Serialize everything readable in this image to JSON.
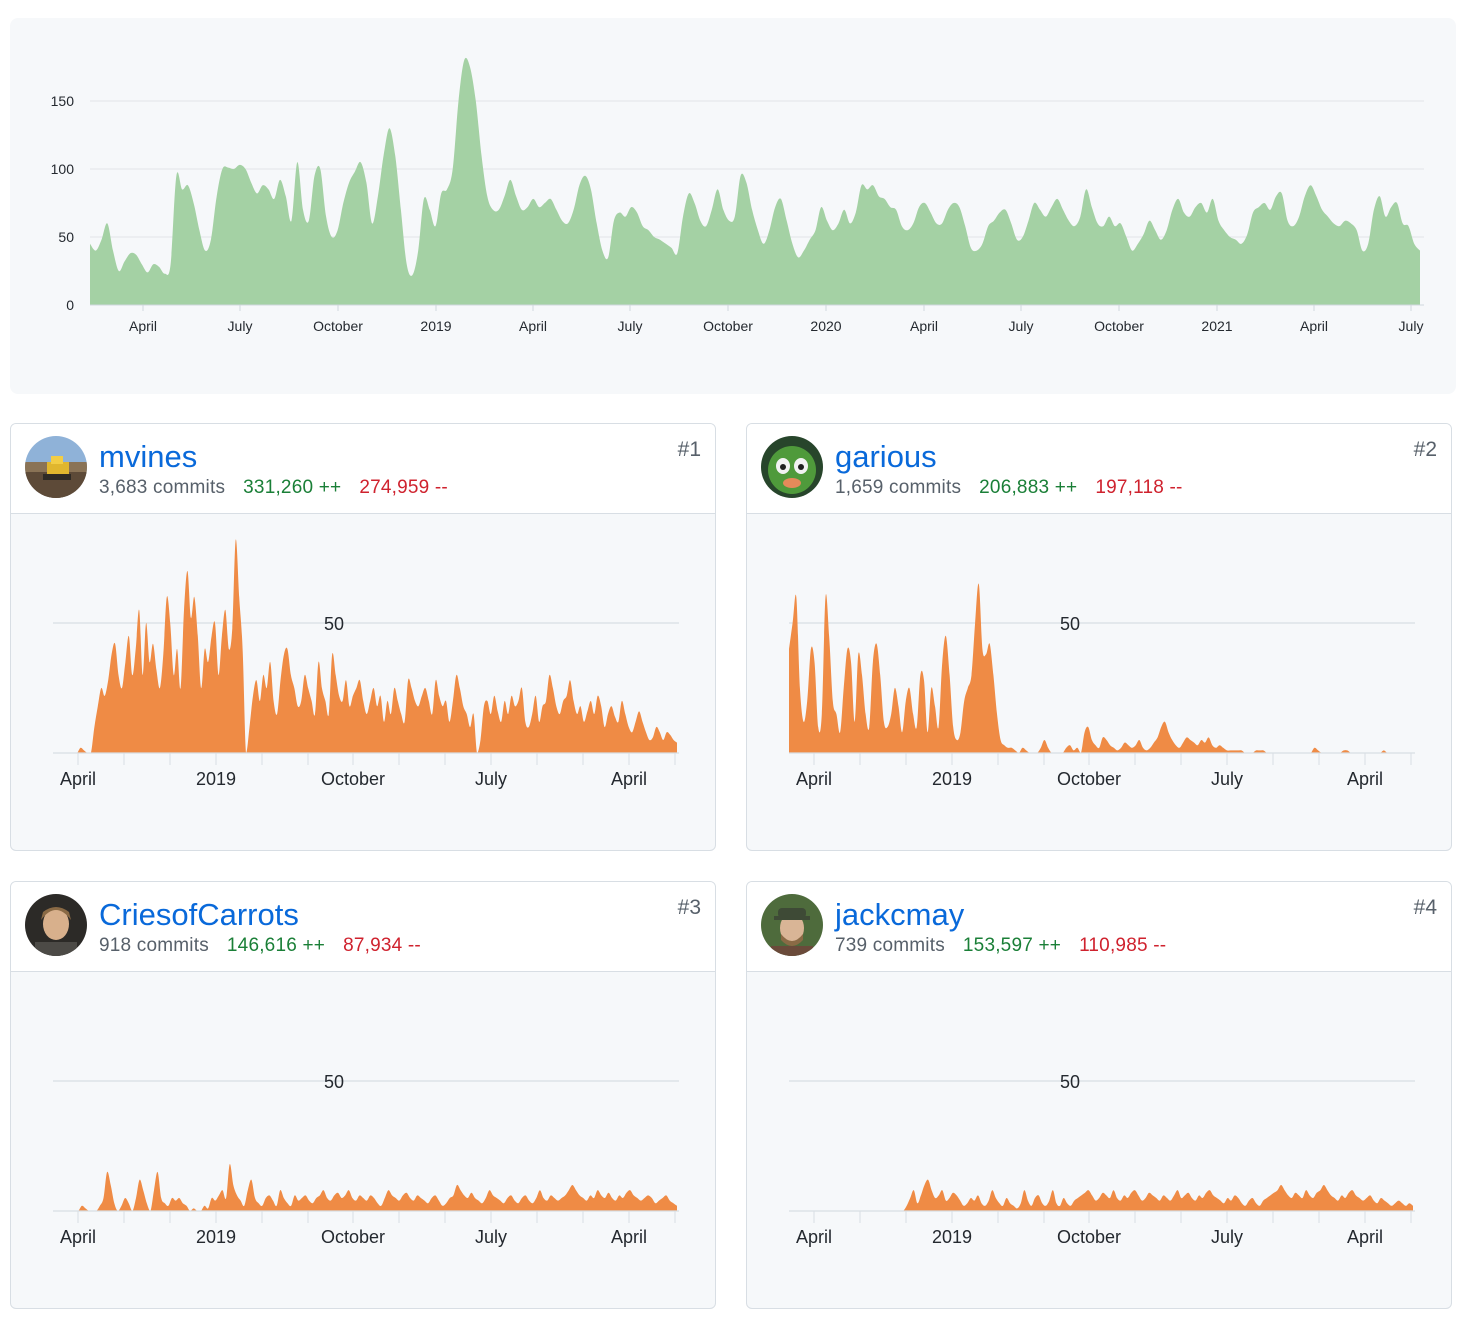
{
  "overview": {
    "chart_data": {
      "type": "area",
      "x_ticks": [
        "April",
        "July",
        "October",
        "2019",
        "April",
        "July",
        "October",
        "2020",
        "April",
        "July",
        "October",
        "2021",
        "April",
        "July"
      ],
      "y_ticks": [
        0,
        50,
        100,
        150
      ],
      "ylim": [
        0,
        190
      ],
      "series": [
        {
          "values": [
            45,
            40,
            48,
            60,
            40,
            25,
            32,
            38,
            37,
            30,
            24,
            30,
            28,
            23,
            30,
            95,
            85,
            88,
            75,
            55,
            40,
            48,
            80,
            100,
            101,
            100,
            103,
            100,
            90,
            82,
            88,
            85,
            78,
            92,
            80,
            62,
            105,
            70,
            62,
            95,
            100,
            65,
            50,
            55,
            75,
            90,
            98,
            105,
            90,
            60,
            80,
            110,
            130,
            110,
            70,
            30,
            22,
            40,
            78,
            70,
            58,
            82,
            85,
            100,
            150,
            180,
            175,
            150,
            110,
            80,
            70,
            70,
            80,
            92,
            80,
            70,
            72,
            78,
            72,
            75,
            78,
            70,
            62,
            60,
            70,
            88,
            95,
            85,
            60,
            40,
            35,
            62,
            68,
            65,
            72,
            68,
            58,
            55,
            50,
            48,
            45,
            42,
            38,
            65,
            82,
            75,
            62,
            58,
            70,
            85,
            70,
            62,
            65,
            95,
            90,
            70,
            55,
            45,
            55,
            72,
            78,
            62,
            45,
            35,
            40,
            48,
            55,
            72,
            62,
            55,
            60,
            70,
            60,
            68,
            88,
            85,
            88,
            80,
            78,
            72,
            70,
            58,
            55,
            60,
            72,
            75,
            68,
            60,
            60,
            70,
            75,
            72,
            58,
            42,
            40,
            45,
            58,
            62,
            68,
            70,
            60,
            48,
            50,
            62,
            75,
            70,
            65,
            72,
            78,
            70,
            62,
            58,
            65,
            85,
            72,
            60,
            58,
            65,
            58,
            60,
            50,
            40,
            45,
            52,
            62,
            55,
            48,
            55,
            70,
            78,
            68,
            65,
            72,
            75,
            68,
            78,
            62,
            55,
            50,
            48,
            45,
            52,
            68,
            72,
            75,
            70,
            80,
            82,
            62,
            58,
            65,
            80,
            88,
            80,
            70,
            65,
            60,
            58,
            62,
            60,
            55,
            40,
            45,
            70,
            80,
            65,
            72,
            75,
            60,
            58,
            45,
            40
          ]
        }
      ]
    }
  },
  "contributors": [
    {
      "rank": "#1",
      "username": "mvines",
      "commits": "3,683 commits",
      "additions": "331,260 ++",
      "deletions": "274,959 --",
      "avatar_icon": "bulldozer-avatar-icon",
      "chart_data": {
        "type": "area",
        "x_ticks": [
          "April",
          "2019",
          "October",
          "July",
          "April"
        ],
        "gridline_label": "50",
        "ylim": [
          0,
          80
        ],
        "series": [
          {
            "values": [
              0,
              0,
              0,
              0,
              0,
              0,
              0,
              0,
              2,
              1,
              0,
              0,
              10,
              18,
              25,
              22,
              28,
              38,
              42,
              30,
              25,
              35,
              45,
              30,
              40,
              55,
              30,
              50,
              35,
              42,
              32,
              25,
              38,
              60,
              50,
              30,
              40,
              25,
              55,
              70,
              52,
              60,
              45,
              25,
              40,
              35,
              45,
              50,
              30,
              45,
              55,
              40,
              48,
              82,
              60,
              40,
              0,
              10,
              22,
              28,
              20,
              30,
              25,
              35,
              20,
              15,
              28,
              38,
              40,
              30,
              25,
              18,
              20,
              30,
              25,
              20,
              15,
              35,
              25,
              20,
              15,
              38,
              30,
              22,
              20,
              28,
              18,
              22,
              25,
              28,
              20,
              15,
              20,
              25,
              18,
              22,
              12,
              20,
              15,
              25,
              20,
              15,
              12,
              28,
              25,
              20,
              18,
              22,
              25,
              20,
              15,
              28,
              22,
              18,
              20,
              12,
              20,
              30,
              25,
              18,
              15,
              10,
              15,
              0,
              5,
              18,
              20,
              15,
              22,
              16,
              12,
              20,
              15,
              22,
              18,
              20,
              25,
              12,
              10,
              15,
              22,
              12,
              18,
              20,
              30,
              25,
              18,
              15,
              20,
              22,
              28,
              20,
              15,
              18,
              12,
              16,
              20,
              15,
              22,
              18,
              10,
              15,
              18,
              14,
              12,
              20,
              15,
              10,
              8,
              12,
              16,
              12,
              8,
              5,
              6,
              10,
              8,
              5,
              8,
              7,
              5,
              4
            ],
            "color": "#ef8b45"
          }
        ]
      }
    },
    {
      "rank": "#2",
      "username": "garious",
      "commits": "1,659 commits",
      "additions": "206,883 ++",
      "deletions": "197,118 --",
      "avatar_icon": "green-mask-avatar-icon",
      "chart_data": {
        "type": "area",
        "x_ticks": [
          "April",
          "2019",
          "October",
          "July",
          "April"
        ],
        "gridline_label": "50",
        "ylim": [
          0,
          80
        ],
        "series": [
          {
            "values": [
              40,
              50,
              60,
              25,
              12,
              20,
              40,
              35,
              10,
              15,
              60,
              45,
              20,
              15,
              8,
              25,
              40,
              35,
              12,
              38,
              30,
              15,
              10,
              35,
              42,
              30,
              12,
              10,
              15,
              25,
              18,
              8,
              20,
              25,
              15,
              10,
              30,
              28,
              8,
              25,
              18,
              10,
              35,
              45,
              30,
              10,
              5,
              8,
              20,
              25,
              30,
              50,
              65,
              40,
              38,
              42,
              30,
              15,
              5,
              3,
              2,
              2,
              1,
              0,
              2,
              1,
              0,
              0,
              0,
              2,
              5,
              2,
              0,
              0,
              0,
              0,
              2,
              3,
              1,
              2,
              0,
              8,
              10,
              5,
              3,
              2,
              6,
              5,
              3,
              2,
              1,
              2,
              4,
              3,
              2,
              3,
              5,
              2,
              1,
              2,
              4,
              6,
              10,
              12,
              8,
              5,
              3,
              2,
              4,
              6,
              5,
              4,
              3,
              5,
              4,
              6,
              3,
              2,
              3,
              2,
              1,
              1,
              1,
              1,
              1,
              0,
              0,
              0,
              1,
              1,
              1,
              0,
              0,
              0,
              0,
              0,
              0,
              0,
              0,
              0,
              0,
              0,
              0,
              0,
              2,
              1,
              0,
              0,
              0,
              0,
              0,
              0,
              1,
              1,
              0,
              0,
              0,
              0,
              0,
              0,
              0,
              0,
              0,
              1,
              0,
              0,
              0,
              0,
              0,
              0,
              0,
              0
            ],
            "color": "#ef8b45"
          }
        ]
      }
    },
    {
      "rank": "#3",
      "username": "CriesofCarrots",
      "commits": "918 commits",
      "additions": "146,616 ++",
      "deletions": "87,934 --",
      "avatar_icon": "person-avatar-icon",
      "chart_data": {
        "type": "area",
        "x_ticks": [
          "April",
          "2019",
          "October",
          "July",
          "April"
        ],
        "gridline_label": "50",
        "ylim": [
          0,
          80
        ],
        "series": [
          {
            "values": [
              0,
              0,
              0,
              0,
              0,
              0,
              0,
              0,
              2,
              1,
              0,
              0,
              0,
              2,
              5,
              15,
              10,
              3,
              0,
              2,
              5,
              3,
              0,
              5,
              12,
              8,
              3,
              0,
              8,
              15,
              5,
              3,
              2,
              5,
              4,
              5,
              3,
              2,
              0,
              1,
              0,
              0,
              2,
              1,
              5,
              4,
              6,
              8,
              5,
              18,
              10,
              6,
              4,
              2,
              8,
              12,
              5,
              3,
              2,
              5,
              6,
              4,
              2,
              8,
              5,
              3,
              2,
              6,
              4,
              5,
              6,
              4,
              3,
              5,
              6,
              8,
              5,
              4,
              6,
              7,
              5,
              6,
              8,
              5,
              4,
              6,
              5,
              4,
              6,
              5,
              3,
              2,
              5,
              8,
              6,
              5,
              4,
              6,
              7,
              5,
              4,
              6,
              5,
              4,
              3,
              5,
              6,
              4,
              2,
              3,
              5,
              6,
              10,
              8,
              6,
              5,
              7,
              5,
              4,
              3,
              5,
              8,
              6,
              5,
              4,
              3,
              5,
              6,
              4,
              3,
              5,
              6,
              4,
              3,
              5,
              8,
              5,
              4,
              6,
              5,
              4,
              5,
              6,
              8,
              10,
              8,
              6,
              5,
              4,
              6,
              5,
              8,
              6,
              5,
              7,
              5,
              4,
              6,
              5,
              7,
              8,
              6,
              5,
              4,
              5,
              6,
              5,
              3,
              4,
              5,
              6,
              4,
              3,
              2
            ],
            "color": "#ef8b45"
          }
        ]
      }
    },
    {
      "rank": "#4",
      "username": "jackcmay",
      "commits": "739 commits",
      "additions": "153,597 ++",
      "deletions": "110,985 --",
      "avatar_icon": "person-hat-avatar-icon",
      "chart_data": {
        "type": "area",
        "x_ticks": [
          "April",
          "2019",
          "October",
          "July",
          "April"
        ],
        "gridline_label": "50",
        "ylim": [
          0,
          80
        ],
        "series": [
          {
            "values": [
              0,
              0,
              0,
              0,
              0,
              0,
              0,
              0,
              0,
              0,
              0,
              0,
              0,
              0,
              0,
              0,
              0,
              0,
              0,
              0,
              0,
              0,
              0,
              0,
              0,
              0,
              0,
              0,
              0,
              0,
              0,
              0,
              0,
              2,
              5,
              8,
              3,
              6,
              10,
              12,
              8,
              5,
              6,
              8,
              4,
              5,
              7,
              6,
              4,
              2,
              3,
              5,
              4,
              6,
              3,
              2,
              4,
              8,
              5,
              3,
              2,
              5,
              3,
              2,
              1,
              3,
              8,
              4,
              2,
              5,
              6,
              3,
              2,
              4,
              8,
              3,
              2,
              5,
              3,
              2,
              4,
              5,
              6,
              7,
              8,
              6,
              4,
              5,
              7,
              6,
              5,
              8,
              5,
              4,
              6,
              5,
              7,
              8,
              6,
              4,
              5,
              7,
              6,
              5,
              4,
              6,
              5,
              4,
              6,
              8,
              5,
              6,
              7,
              5,
              4,
              6,
              5,
              7,
              8,
              6,
              5,
              4,
              3,
              5,
              4,
              6,
              5,
              3,
              2,
              4,
              5,
              3,
              2,
              4,
              5,
              6,
              7,
              8,
              10,
              8,
              6,
              5,
              7,
              6,
              5,
              8,
              6,
              5,
              7,
              8,
              10,
              8,
              6,
              5,
              4,
              6,
              5,
              7,
              8,
              6,
              5,
              4,
              5,
              6,
              4,
              3,
              5,
              4,
              3,
              2,
              3,
              4,
              3,
              2,
              3,
              2
            ],
            "color": "#ef8b45"
          }
        ]
      }
    }
  ],
  "colors": {
    "overview_fill": "#a4d1a4",
    "contributor_fill": "#ef8b45",
    "link": "#0969da",
    "additions": "#1a7f37",
    "deletions": "#cf222e"
  }
}
